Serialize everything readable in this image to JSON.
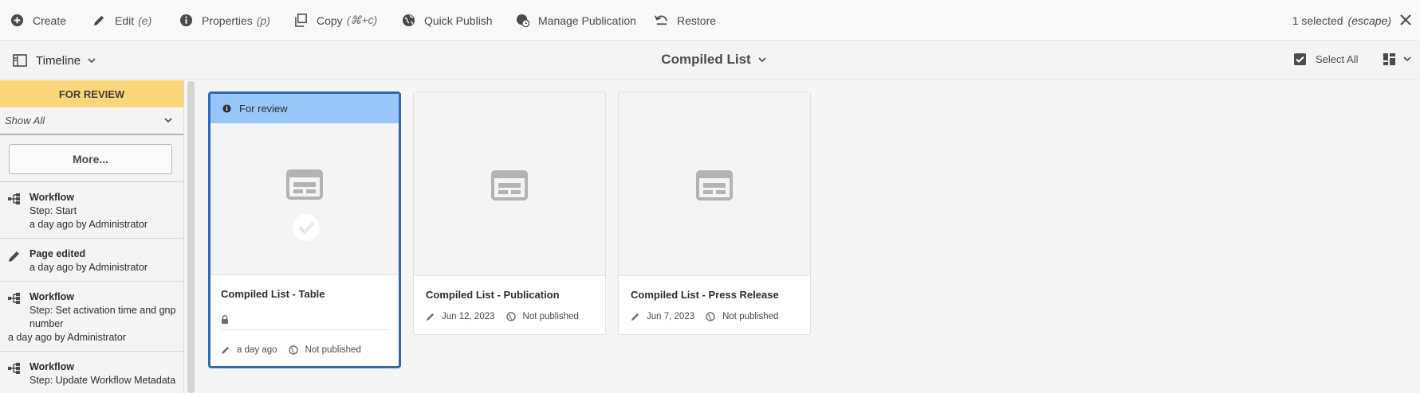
{
  "actionbar": {
    "create": "Create",
    "edit": "Edit",
    "edit_key": "(e)",
    "properties": "Properties",
    "properties_key": "(p)",
    "copy": "Copy",
    "copy_key": "(⌘+c)",
    "quick_publish": "Quick Publish",
    "manage_publication": "Manage Publication",
    "restore": "Restore",
    "selected_count": "1 selected",
    "escape_hint": "(escape)"
  },
  "titlebar": {
    "rail_label": "Timeline",
    "page_title": "Compiled List",
    "select_all": "Select All"
  },
  "rail": {
    "header": "FOR REVIEW",
    "filter": "Show All",
    "more_button": "More...",
    "items": [
      {
        "icon": "workflow-icon",
        "title": "Workflow",
        "line1": "Step: Start",
        "line2": "a day ago by Administrator"
      },
      {
        "icon": "pencil-icon",
        "title": "Page edited",
        "line1": "a day ago by Administrator"
      },
      {
        "icon": "workflow-icon",
        "title": "Workflow",
        "line1": "Step: Set activation time and gnp number",
        "line2": "a day ago by Administrator"
      },
      {
        "icon": "workflow-icon",
        "title": "Workflow",
        "line1": "Step: Update Workflow Metadata"
      }
    ]
  },
  "cards": [
    {
      "title": "Compiled List - Table",
      "status_banner": "For review",
      "modified": "a day ago",
      "publication": "Not published",
      "selected": true,
      "locked": true
    },
    {
      "title": "Compiled List - Publication",
      "modified": "Jun 12, 2023",
      "publication": "Not published",
      "selected": false
    },
    {
      "title": "Compiled List - Press Release",
      "modified": "Jun 7, 2023",
      "publication": "Not published",
      "selected": false
    }
  ],
  "colors": {
    "accent_selected": "#2c67c7",
    "review_header": "#fcd77a",
    "status_banner": "#97c6f9"
  }
}
